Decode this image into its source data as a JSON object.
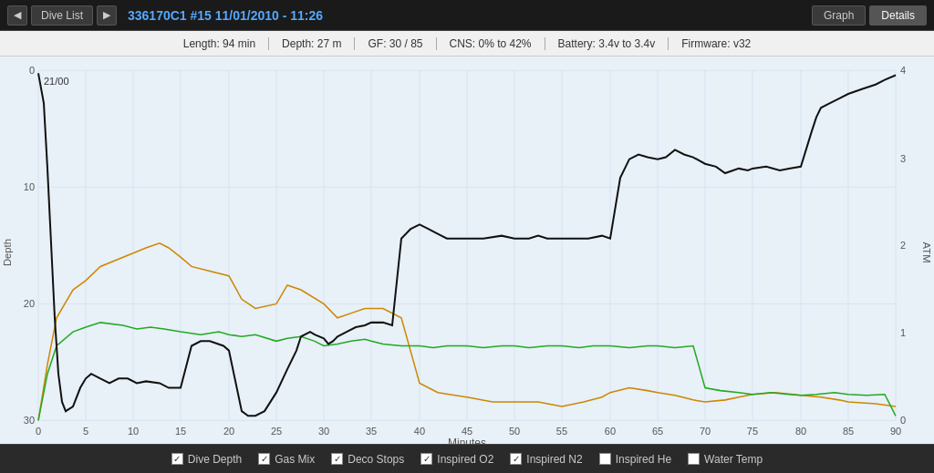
{
  "topBar": {
    "prevBtn": "<",
    "nextBtn": ">",
    "diveListBtn": "Dive List",
    "title": "336170C1 #15  11/01/2010 - 11:26",
    "graphBtn": "Graph",
    "detailsBtn": "Details"
  },
  "infoBar": {
    "length": "Length: 94 min",
    "depth": "Depth: 27 m",
    "gf": "GF: 30 / 85",
    "cns": "CNS: 0% to 42%",
    "battery": "Battery: 3.4v to 3.4v",
    "firmware": "Firmware: v32"
  },
  "chart": {
    "yLeftLabel": "Depth",
    "yRightLabel": "ATM",
    "yLeftTicks": [
      "0",
      "10",
      "20",
      "30"
    ],
    "yRightTicks": [
      "4",
      "3",
      "2",
      "1",
      "0"
    ],
    "xLabel": "Minutes",
    "xTicks": [
      "0",
      "5",
      "10",
      "15",
      "20",
      "25",
      "30",
      "35",
      "40",
      "45",
      "50",
      "55",
      "60",
      "65",
      "70",
      "75",
      "80",
      "85",
      "90"
    ],
    "annotation": "21/00"
  },
  "legend": [
    {
      "label": "Dive Depth",
      "checked": true,
      "color": "#000000"
    },
    {
      "label": "Gas Mix",
      "checked": true,
      "color": "#cc8800"
    },
    {
      "label": "Deco Stops",
      "checked": true,
      "color": "#cc8800"
    },
    {
      "label": "Inspired O2",
      "checked": true,
      "color": "#000000"
    },
    {
      "label": "Inspired N2",
      "checked": true,
      "color": "#22aa22"
    },
    {
      "label": "Inspired He",
      "checked": false,
      "color": "#aaaaaa"
    },
    {
      "label": "Water Temp",
      "checked": false,
      "color": "#aaaaaa"
    }
  ],
  "footer": {
    "inspiredO2": "Inspired 02"
  }
}
